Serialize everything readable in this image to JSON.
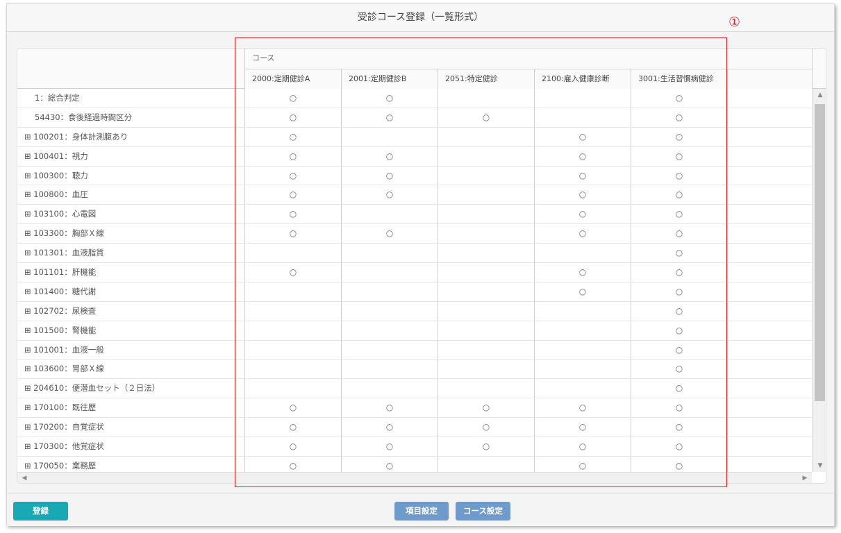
{
  "window": {
    "title": "受診コース登録（一覧形式）"
  },
  "annotation": {
    "marker": "①",
    "color": "#e02020"
  },
  "grid": {
    "group_header": "コース",
    "columns": [
      "2000:定期健診A",
      "2001:定期健診B",
      "2051:特定健診",
      "2100:雇入健康診断",
      "3001:生活習慣病健診"
    ],
    "check_mark": "○",
    "rows": [
      {
        "label": "1：総合判定",
        "expandable": false,
        "cells": [
          true,
          true,
          false,
          false,
          true
        ]
      },
      {
        "label": "54430：食後経過時間区分",
        "expandable": false,
        "cells": [
          true,
          true,
          true,
          false,
          true
        ]
      },
      {
        "label": "⊞ 100201：身体計測腹あり",
        "expandable": true,
        "cells": [
          true,
          false,
          false,
          true,
          true
        ]
      },
      {
        "label": "⊞ 100401：視力",
        "expandable": true,
        "cells": [
          true,
          true,
          false,
          true,
          true
        ]
      },
      {
        "label": "⊞ 100300：聴力",
        "expandable": true,
        "cells": [
          true,
          true,
          false,
          true,
          true
        ]
      },
      {
        "label": "⊞ 100800：血圧",
        "expandable": true,
        "cells": [
          true,
          true,
          false,
          true,
          true
        ]
      },
      {
        "label": "⊞ 103100：心電図",
        "expandable": true,
        "cells": [
          true,
          false,
          false,
          true,
          true
        ]
      },
      {
        "label": "⊞ 103300：胸部Ｘ線",
        "expandable": true,
        "cells": [
          true,
          true,
          false,
          true,
          true
        ]
      },
      {
        "label": "⊞ 101301：血液脂質",
        "expandable": true,
        "cells": [
          false,
          false,
          false,
          false,
          true
        ]
      },
      {
        "label": "⊞ 101101：肝機能",
        "expandable": true,
        "cells": [
          true,
          false,
          false,
          true,
          true
        ]
      },
      {
        "label": "⊞ 101400：糖代謝",
        "expandable": true,
        "cells": [
          false,
          false,
          false,
          true,
          true
        ]
      },
      {
        "label": "⊞ 102702：尿検査",
        "expandable": true,
        "cells": [
          false,
          false,
          false,
          false,
          true
        ]
      },
      {
        "label": "⊞ 101500：腎機能",
        "expandable": true,
        "cells": [
          false,
          false,
          false,
          false,
          true
        ]
      },
      {
        "label": "⊞ 101001：血液一般",
        "expandable": true,
        "cells": [
          false,
          false,
          false,
          false,
          true
        ]
      },
      {
        "label": "⊞ 103600：胃部Ｘ線",
        "expandable": true,
        "cells": [
          false,
          false,
          false,
          false,
          true
        ]
      },
      {
        "label": "⊞ 204610：便潜血セット（２日法）",
        "expandable": true,
        "cells": [
          false,
          false,
          false,
          false,
          true
        ]
      },
      {
        "label": "⊞ 170100：既往歴",
        "expandable": true,
        "cells": [
          true,
          true,
          true,
          true,
          true
        ]
      },
      {
        "label": "⊞ 170200：自覚症状",
        "expandable": true,
        "cells": [
          true,
          true,
          true,
          true,
          true
        ]
      },
      {
        "label": "⊞ 170300：他覚症状",
        "expandable": true,
        "cells": [
          true,
          true,
          true,
          true,
          true
        ]
      },
      {
        "label": "⊞ 170050：業務歴",
        "expandable": true,
        "cells": [
          true,
          true,
          false,
          true,
          true
        ]
      }
    ]
  },
  "footer": {
    "register_label": "登録",
    "item_settings_label": "項目設定",
    "course_settings_label": "コース設定"
  },
  "colors": {
    "register_button": "#18a9b5",
    "secondary_button": "#6f9bcc"
  },
  "scrollbar": {
    "up_icon": "triangle-up-icon",
    "down_icon": "triangle-down-icon"
  }
}
